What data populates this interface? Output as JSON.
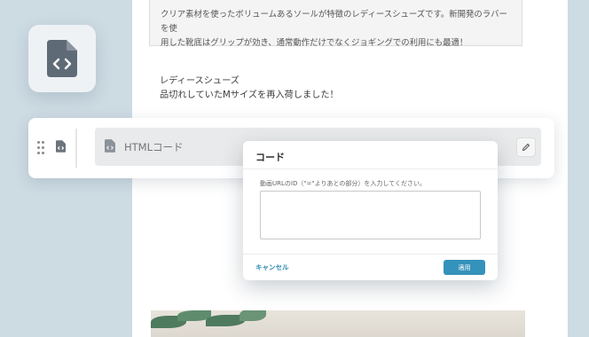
{
  "product": {
    "description_lines": [
      "クリア素材を使ったボリュームあるソールが特徴のレディースシューズです。新開発のラバーを使",
      "用した靴底はグリップが効き、通常動作だけでなくジョギングでの利用にも最適！"
    ],
    "notice_lines": [
      "レディースシューズ",
      "品切れしていたMサイズを再入荷しました！"
    ]
  },
  "block": {
    "label": "HTMLコード",
    "drag_icon": "drag-handle-icon",
    "type_icon": "code-file-icon",
    "edit_icon": "pencil-icon"
  },
  "modal": {
    "title": "コード",
    "prompt": "動画URLのID（\"=\"よりあとの部分）を入力してください。",
    "textarea_value": "",
    "cancel_label": "キャンセル",
    "apply_label": "適用"
  },
  "colors": {
    "accent": "#3592bb",
    "link": "#2d8bb3",
    "background": "#cddbe3",
    "icon": "#5f6a77"
  }
}
